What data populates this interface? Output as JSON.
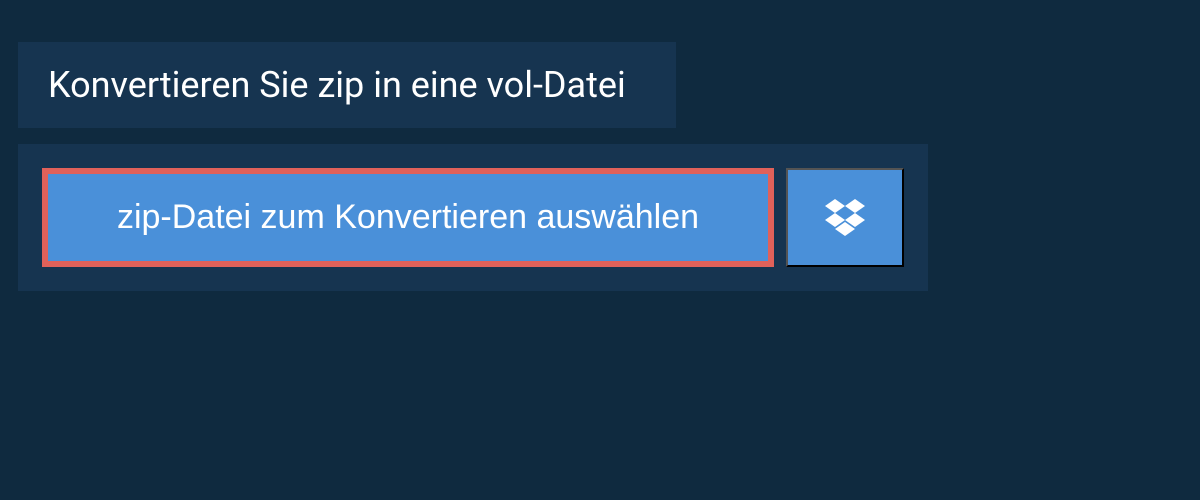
{
  "header": {
    "title": "Konvertieren Sie zip in eine vol-Datei"
  },
  "actions": {
    "select_file_label": "zip-Datei zum Konvertieren auswählen"
  },
  "colors": {
    "page_bg": "#0f2a3f",
    "panel_bg": "#163450",
    "button_bg": "#4a90d9",
    "highlight_border": "#e0615a",
    "text": "#ffffff"
  }
}
